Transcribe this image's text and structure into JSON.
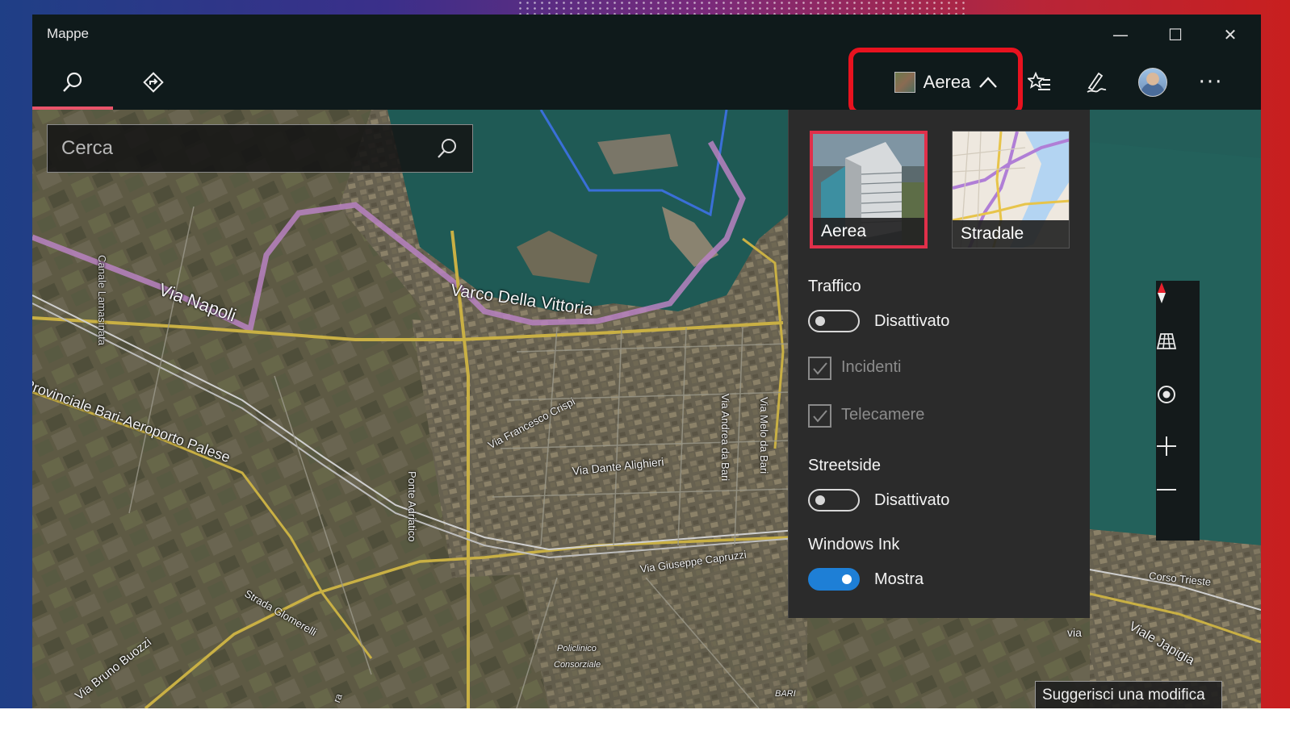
{
  "window": {
    "title": "Mappe",
    "controls": {
      "minimize": "—",
      "maximize": "☐",
      "close": "✕"
    }
  },
  "toolbar": {
    "search_icon": "search-icon",
    "directions_icon": "directions-icon",
    "map_style_label": "Aerea",
    "favorites_icon": "favorites-icon",
    "ink_icon": "ink-icon",
    "more_label": "···"
  },
  "search": {
    "placeholder": "Cerca"
  },
  "map_labels": {
    "via_napoli": "Via Napoli",
    "varco": "Varco Della Vittoria",
    "canale": "Canale Lamasinata",
    "provinciale": "Provinciale Bari-Aeroporto Palese",
    "crispi": "Via Francesco Crispi",
    "alighieri": "Via Dante Alighieri",
    "andrea": "Via Andrea da Bari",
    "melo": "Via Melo da Bari",
    "ponte": "Ponte Adriatico",
    "capruzzi": "Via Giuseppe Capruzzi",
    "glomerelli": "Strada Glomerelli",
    "buozzi": "Via Bruno Buozzi",
    "policlinico": "Policlinico",
    "consorziale": "Consorziale",
    "bari": "BARI",
    "corso_trieste": "Corso Trieste",
    "japigia": "Viale Japigia",
    "via_partial": "via",
    "ra_partial": "ra"
  },
  "panel": {
    "styles": [
      {
        "label": "Aerea",
        "selected": true
      },
      {
        "label": "Stradale",
        "selected": false
      }
    ],
    "traffic": {
      "heading": "Traffico",
      "toggle_label": "Disattivato",
      "on": false
    },
    "incidents": {
      "label": "Incidenti",
      "checked": true,
      "enabled": false
    },
    "cameras": {
      "label": "Telecamere",
      "checked": true,
      "enabled": false
    },
    "streetside": {
      "heading": "Streetside",
      "toggle_label": "Disattivato",
      "on": false
    },
    "ink": {
      "heading": "Windows Ink",
      "toggle_label": "Mostra",
      "on": true
    }
  },
  "map_controls": [
    "compass-icon",
    "tilt-icon",
    "location-icon",
    "zoom-in-icon",
    "zoom-out-icon"
  ],
  "suggest_button": "Suggerisci una modifica",
  "colors": {
    "accent_pink": "#e8546a",
    "highlight_red": "#e8121f",
    "toggle_on": "#1e7fd6",
    "sea": "#1f5a55"
  }
}
